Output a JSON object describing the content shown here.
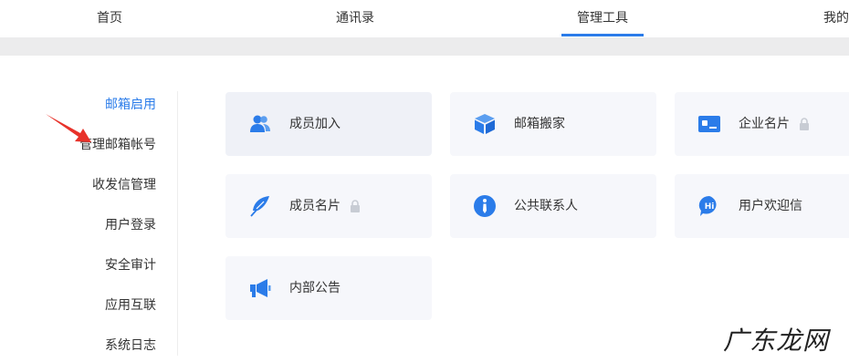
{
  "topnav": {
    "tabs": [
      {
        "label": "首页"
      },
      {
        "label": "通讯录"
      },
      {
        "label": "管理工具"
      },
      {
        "label": "我的"
      }
    ]
  },
  "sidebar": {
    "items": [
      {
        "label": "邮箱启用"
      },
      {
        "label": "管理邮箱帐号"
      },
      {
        "label": "收发信管理"
      },
      {
        "label": "用户登录"
      },
      {
        "label": "安全审计"
      },
      {
        "label": "应用互联"
      },
      {
        "label": "系统日志"
      }
    ]
  },
  "tools": [
    {
      "label": "成员加入",
      "icon": "members-icon"
    },
    {
      "label": "邮箱搬家",
      "icon": "box-icon"
    },
    {
      "label": "企业名片",
      "icon": "business-card-icon",
      "locked": true
    },
    {
      "label": "成员名片",
      "icon": "feather-icon",
      "locked": true
    },
    {
      "label": "公共联系人",
      "icon": "info-tie-icon"
    },
    {
      "label": "用户欢迎信",
      "icon": "hi-chat-icon"
    },
    {
      "label": "内部公告",
      "icon": "megaphone-icon"
    }
  ],
  "accent_color": "#2b7ce9",
  "watermark": "广东龙网"
}
